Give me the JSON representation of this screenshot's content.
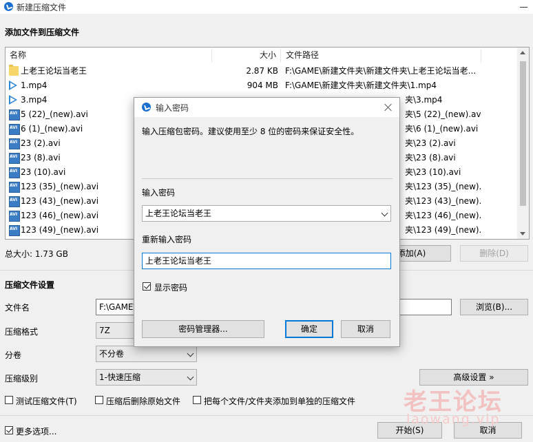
{
  "window": {
    "title": "新建压缩文件"
  },
  "files_section": {
    "heading": "添加文件到压缩文件"
  },
  "file_list": {
    "columns": {
      "name": "名称",
      "size": "大小",
      "path": "文件路径"
    },
    "rows": [
      {
        "icon": "folder-icon",
        "name": "上老王论坛当老王",
        "size": "2.87 KB",
        "path": "F:\\GAME\\新建文件夹\\新建文件夹\\上老王论坛当老..."
      },
      {
        "icon": "video-play-icon",
        "name": "1.mp4",
        "size": "904 MB",
        "path": "F:\\GAME\\新建文件夹\\新建文件夹\\1.mp4"
      },
      {
        "icon": "video-play-icon",
        "name": "3.mp4",
        "size": "",
        "path": "夹\\3.mp4"
      },
      {
        "icon": "avi-file-icon",
        "name": "5 (22)_(new).avi",
        "size": "",
        "path": "夹\\5 (22)_(new).avi"
      },
      {
        "icon": "avi-file-icon",
        "name": "6 (1)_(new).avi",
        "size": "",
        "path": "夹\\6 (1)_(new).avi"
      },
      {
        "icon": "avi-file-icon",
        "name": "23 (2).avi",
        "size": "",
        "path": "夹\\23 (2).avi"
      },
      {
        "icon": "avi-file-icon",
        "name": "23 (8).avi",
        "size": "",
        "path": "夹\\23 (8).avi"
      },
      {
        "icon": "avi-file-icon",
        "name": "23 (10).avi",
        "size": "",
        "path": "夹\\23 (10).avi"
      },
      {
        "icon": "avi-file-icon",
        "name": "123 (35)_(new).avi",
        "size": "",
        "path": "夹\\123 (35)_(new)..."
      },
      {
        "icon": "avi-file-icon",
        "name": "123 (43)_(new).avi",
        "size": "",
        "path": "夹\\123 (43)_(new)..."
      },
      {
        "icon": "avi-file-icon",
        "name": "123 (46)_(new).avi",
        "size": "",
        "path": "夹\\123 (46)_(new)..."
      },
      {
        "icon": "avi-file-icon",
        "name": "123 (49)_(new).avi",
        "size": "",
        "path": "夹\\123 (49)_(new)..."
      }
    ]
  },
  "total_size": "总大小: 1.73 GB",
  "buttons": {
    "add": "添加(A)",
    "delete": "删除(D)",
    "browse": "浏览(B)...",
    "advanced": "高级设置 »",
    "start": "开始(S)",
    "cancel": "取消"
  },
  "settings": {
    "heading": "压缩文件设置",
    "filename_label": "文件名",
    "filename_value": "F:\\GAME\\",
    "format_label": "压缩格式",
    "format_value": "7Z",
    "split_label": "分卷",
    "split_value": "不分卷",
    "level_label": "压缩级别",
    "level_value": "1-快速压缩",
    "test_label": "测试压缩文件(T)",
    "delete_after_label": "压缩后删除原始文件",
    "separate_label": "把每个文件/文件夹添加到单独的压缩文件",
    "more_options_label": "更多选项..."
  },
  "watermark": {
    "text": "老王论坛",
    "sub": "laowang.vip"
  },
  "dialog": {
    "title": "输入密码",
    "description": "输入压缩包密码。建议使用至少 8 位的密码来保证安全性。",
    "password_label": "输入密码",
    "password_value": "上老王论坛当老王",
    "confirm_label": "重新输入密码",
    "confirm_value": "上老王论坛当老王",
    "show_password_label": "显示密码",
    "manager_button": "密码管理器...",
    "ok_button": "确定",
    "cancel_button": "取消"
  }
}
